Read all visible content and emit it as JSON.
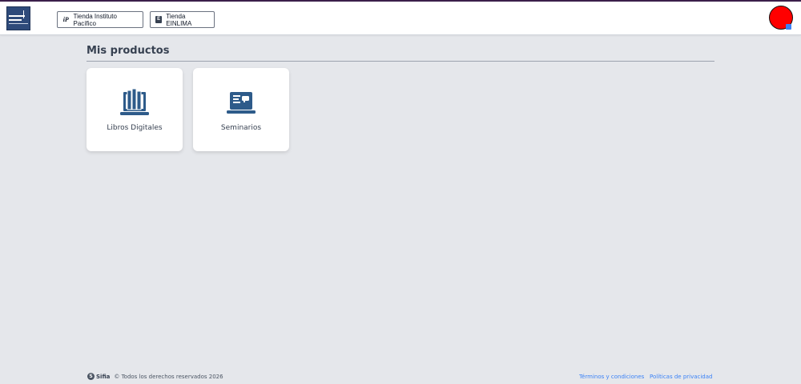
{
  "header": {
    "logo_name": "Instituto Pacífico",
    "stores": [
      {
        "label": "Tienda Instituto Pacífico",
        "icon": "instituto-pacifico-icon"
      },
      {
        "label": "Tienda EINLIMA",
        "icon": "einlima-icon"
      }
    ],
    "avatar_color": "#ff0000"
  },
  "main": {
    "title": "Mis productos",
    "products": [
      {
        "label": "Libros Digitales",
        "icon": "digital-books-icon"
      },
      {
        "label": "Seminarios",
        "icon": "seminars-icon"
      }
    ]
  },
  "footer": {
    "brand": "Sifia",
    "copyright": "©  Todos los derechos reservados  2026",
    "links": [
      "Términos y condiciones",
      "Políticas de privacidad"
    ]
  },
  "colors": {
    "accent": "#2e5b8a",
    "link": "#3b82f6",
    "background": "#e5e7eb"
  }
}
